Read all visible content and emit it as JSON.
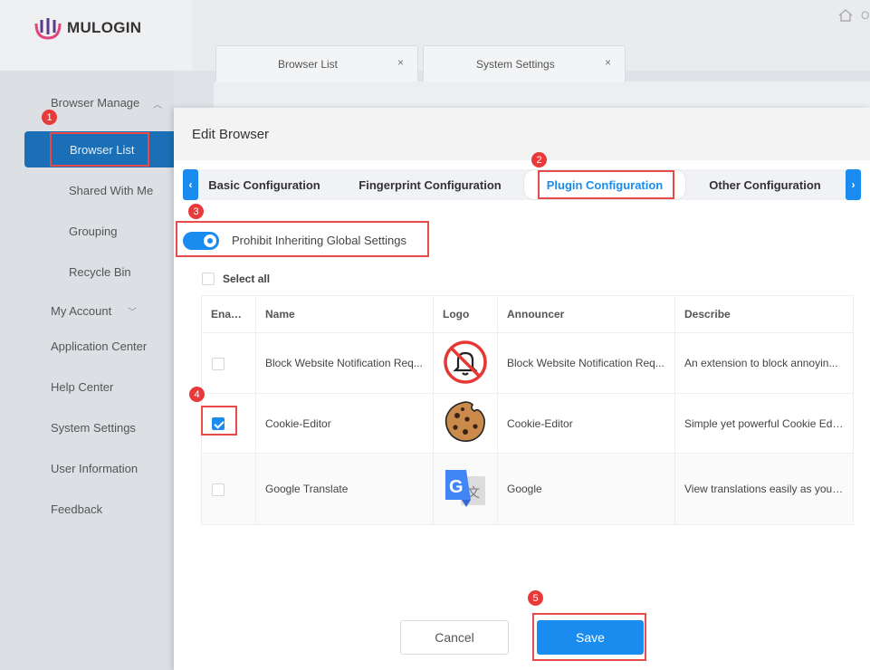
{
  "app": {
    "logo_text": "MULOGIN",
    "home_text": "O"
  },
  "sidebar": {
    "browser_manage": "Browser Manage",
    "browser_list": "Browser List",
    "shared_with_me": "Shared With Me",
    "grouping": "Grouping",
    "recycle_bin": "Recycle Bin",
    "my_account": "My Account",
    "application_center": "Application Center",
    "help_center": "Help Center",
    "system_settings": "System Settings",
    "user_information": "User Information",
    "feedback": "Feedback"
  },
  "top_tabs": [
    {
      "label": "Browser List",
      "close": "×"
    },
    {
      "label": "System Settings",
      "close": "×"
    }
  ],
  "modal": {
    "title": "Edit Browser",
    "tabs": [
      "Basic Configuration",
      "Fingerprint Configuration",
      "Plugin Configuration",
      "Other Configuration"
    ],
    "active_tab": "Plugin Configuration",
    "prev_arrow": "‹",
    "next_arrow": "›",
    "toggle_label": "Prohibit Inheriting Global Settings",
    "toggle_on": true,
    "select_all": "Select all",
    "columns": [
      "Enable",
      "Name",
      "Logo",
      "Announcer",
      "Describe"
    ],
    "rows": [
      {
        "enabled": false,
        "name": "Block Website Notification Req...",
        "logo": "bell-blocked-icon",
        "announcer": "Block Website Notification Req...",
        "describe": "An extension to block annoyin..."
      },
      {
        "enabled": true,
        "name": "Cookie-Editor",
        "logo": "cookie-icon",
        "announcer": "Cookie-Editor",
        "describe": "Simple yet powerful Cookie Edi..."
      },
      {
        "enabled": false,
        "name": "Google Translate",
        "logo": "google-translate-icon",
        "announcer": "Google",
        "describe": "View translations easily as you ..."
      }
    ],
    "cancel": "Cancel",
    "save": "Save"
  },
  "annotations": [
    "1",
    "2",
    "3",
    "4",
    "5"
  ],
  "colors": {
    "primary": "#1a8cf0",
    "highlight": "#e84a4a",
    "sidebar_active": "#1a6fb6"
  }
}
